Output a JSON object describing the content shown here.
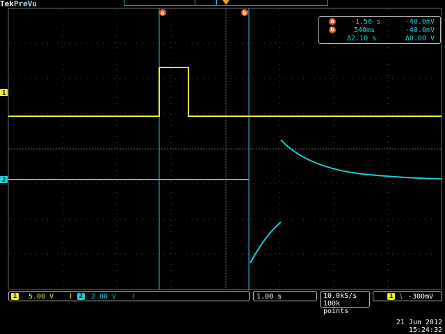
{
  "brand": {
    "tek": "Tek",
    "mode": "PreVu"
  },
  "cursors": {
    "a_label": "a",
    "b_label": "b"
  },
  "readout": {
    "a": {
      "time": "-1.56 s",
      "volts": "-40.0mV"
    },
    "b": {
      "time": "540ms",
      "volts": "-40.0mV"
    },
    "delta": {
      "time": "Δ2.10 s",
      "volts": "Δ0.00 V"
    }
  },
  "channels": {
    "ch1": {
      "number": "1",
      "scale": "5.00 V",
      "coupling": "⌇",
      "color": "#f0f02a"
    },
    "ch2": {
      "number": "2",
      "scale": "2.00 V",
      "coupling": "⌇",
      "color": "#1ed0dc"
    }
  },
  "horizontal": {
    "scale": "1.00 s"
  },
  "acquisition": {
    "rate": "10.0kS/s",
    "points": "100k points"
  },
  "trigger": {
    "source": "1",
    "slope": "⧹",
    "level": "-300mV"
  },
  "datetime": {
    "date": "21 Jun  2012",
    "time": "15:24:32"
  },
  "colors": {
    "graticule": "#6a6a6a",
    "cursor": "#22c9d6",
    "ch1": "#f0f02a",
    "ch2": "#1ed0dc",
    "accent": "#e05a2a"
  }
}
